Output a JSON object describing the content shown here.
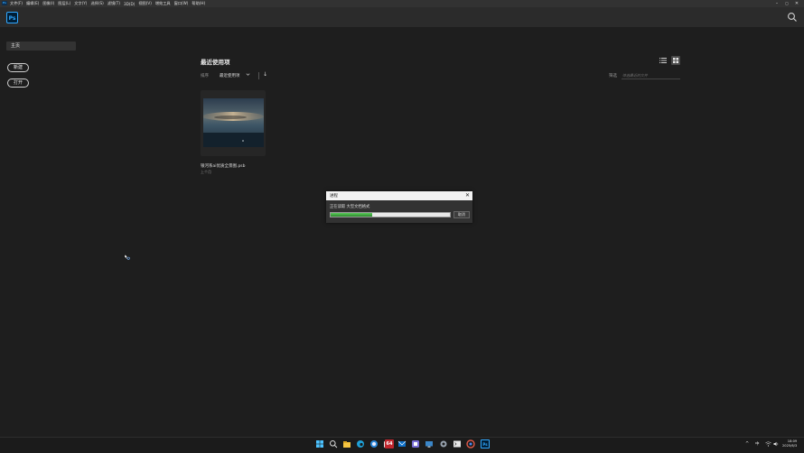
{
  "menubar": {
    "app_icon": "Ps",
    "items": [
      "文件(F)",
      "编辑(E)",
      "图像(I)",
      "图层(L)",
      "文字(Y)",
      "选择(S)",
      "滤镜(T)",
      "3D(D)",
      "视图(V)",
      "增效工具",
      "窗口(W)",
      "帮助(H)"
    ],
    "window_controls": [
      "–",
      "▢",
      "✕"
    ]
  },
  "header": {
    "logo": "Ps",
    "search_icon": "search-icon"
  },
  "sidebar": {
    "home_label": "主页",
    "new_label": "新建",
    "open_label": "打开"
  },
  "main": {
    "title": "最近使用项",
    "sort_label": "排序",
    "sort_value": "最近使用项",
    "sort_order_icon": "↓",
    "filter_label": "筛选",
    "filter_placeholder": "筛选最近的文件",
    "view_modes": [
      "list-view-icon",
      "grid-view-icon"
    ],
    "files": [
      {
        "name": "银河系ai优质全景图.psb",
        "date": "上个月"
      }
    ]
  },
  "dialog": {
    "title": "进程",
    "message": "正在读取 大型文档格式",
    "progress": 0.35,
    "cancel_label": "取消",
    "close_label": "✕"
  },
  "taskbar": {
    "icons": [
      "start-icon",
      "search-icon",
      "file-explorer-icon",
      "edge-icon",
      "browser-icon",
      "store-icon",
      "64-app-icon",
      "mail-icon",
      "app-icon",
      "settings-icon",
      "terminal-icon",
      "app-icon-2",
      "chrome-icon",
      "photoshop-icon"
    ],
    "badge_64": "64",
    "ps_label": "Ps",
    "tray": [
      "^",
      "中",
      "wifi-icon",
      "volume-icon"
    ],
    "ime": "中",
    "time": "18:09",
    "date": "2025/6/3"
  },
  "colors": {
    "accent": "#31a8ff",
    "progress": "#3aa83a",
    "background": "#1e1e1e"
  }
}
